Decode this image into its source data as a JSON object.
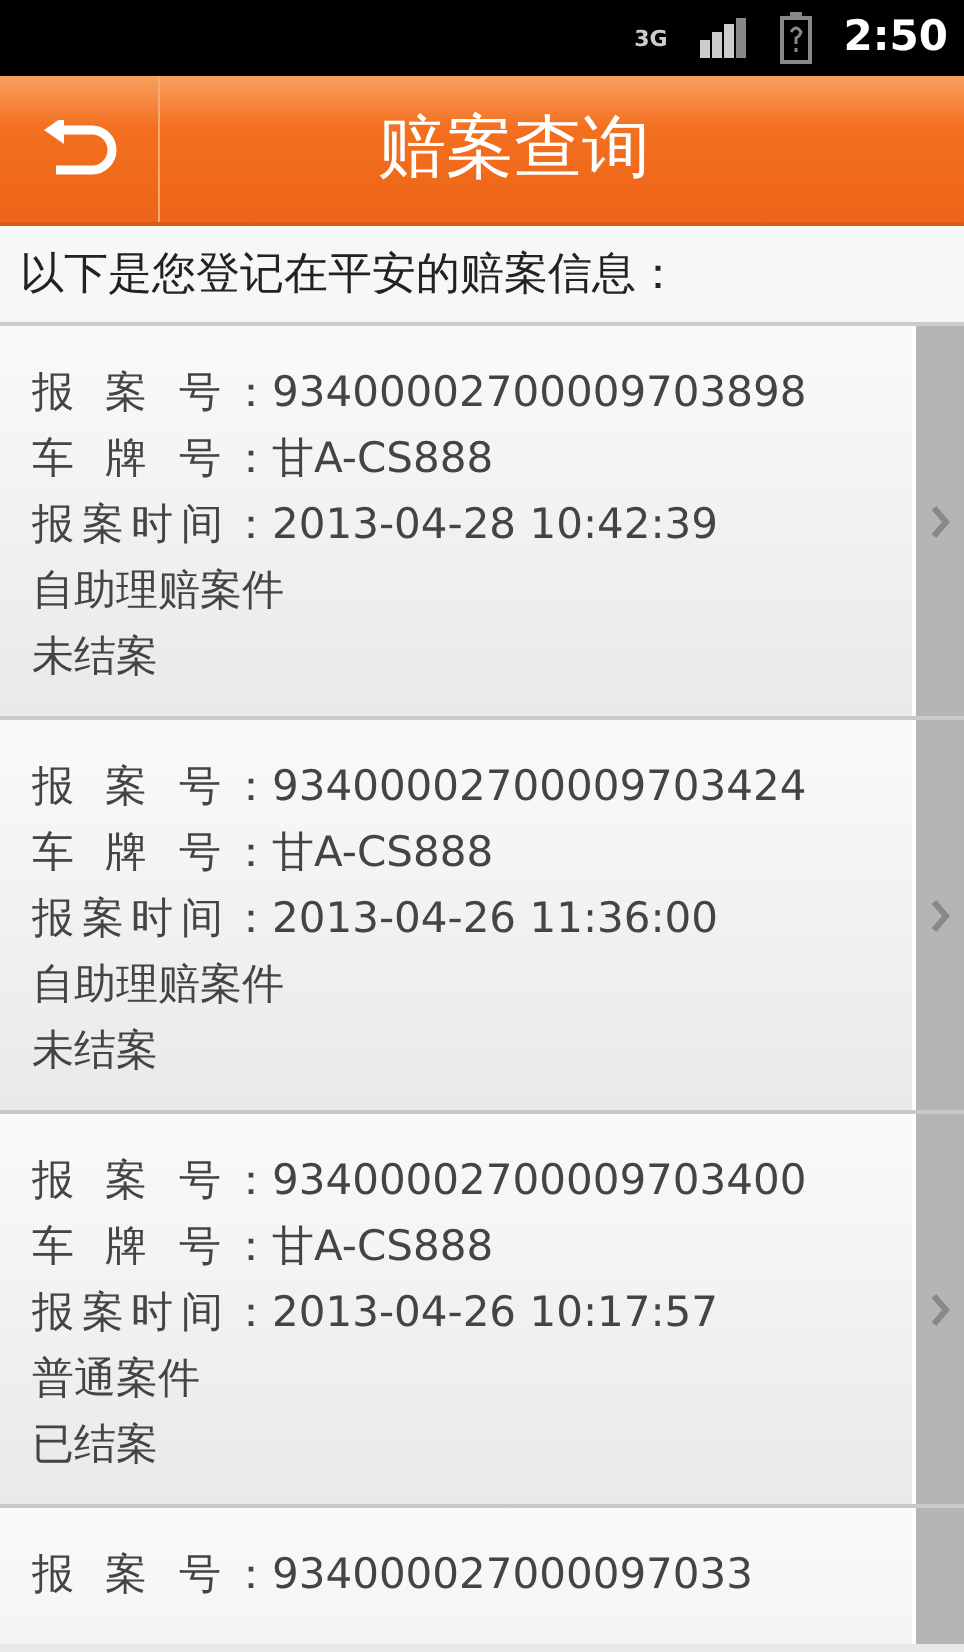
{
  "status_bar": {
    "network": "3G",
    "time": "2:50"
  },
  "header": {
    "title": "赔案查询"
  },
  "intro": "以下是您登记在平安的赔案信息：",
  "claims": [
    {
      "fields": [
        {
          "label": "报 案 号：",
          "value": "93400002700009703898"
        },
        {
          "label": "车 牌 号：",
          "value": "甘A-CS888"
        },
        {
          "label": "报案时间：",
          "value": "2013-04-28 10:42:39"
        }
      ],
      "case_type": "自助理赔案件",
      "status": "未结案"
    },
    {
      "fields": [
        {
          "label": "报 案 号：",
          "value": "93400002700009703424"
        },
        {
          "label": "车 牌 号：",
          "value": "甘A-CS888"
        },
        {
          "label": "报案时间：",
          "value": "2013-04-26 11:36:00"
        }
      ],
      "case_type": "自助理赔案件",
      "status": "未结案"
    },
    {
      "fields": [
        {
          "label": "报 案 号：",
          "value": "93400002700009703400"
        },
        {
          "label": "车 牌 号：",
          "value": "甘A-CS888"
        },
        {
          "label": "报案时间：",
          "value": "2013-04-26 10:17:57"
        }
      ],
      "case_type": "普通案件",
      "status": "已结案"
    },
    {
      "fields": [
        {
          "label": "报 案 号：",
          "value": "934000027000097033"
        }
      ]
    }
  ]
}
